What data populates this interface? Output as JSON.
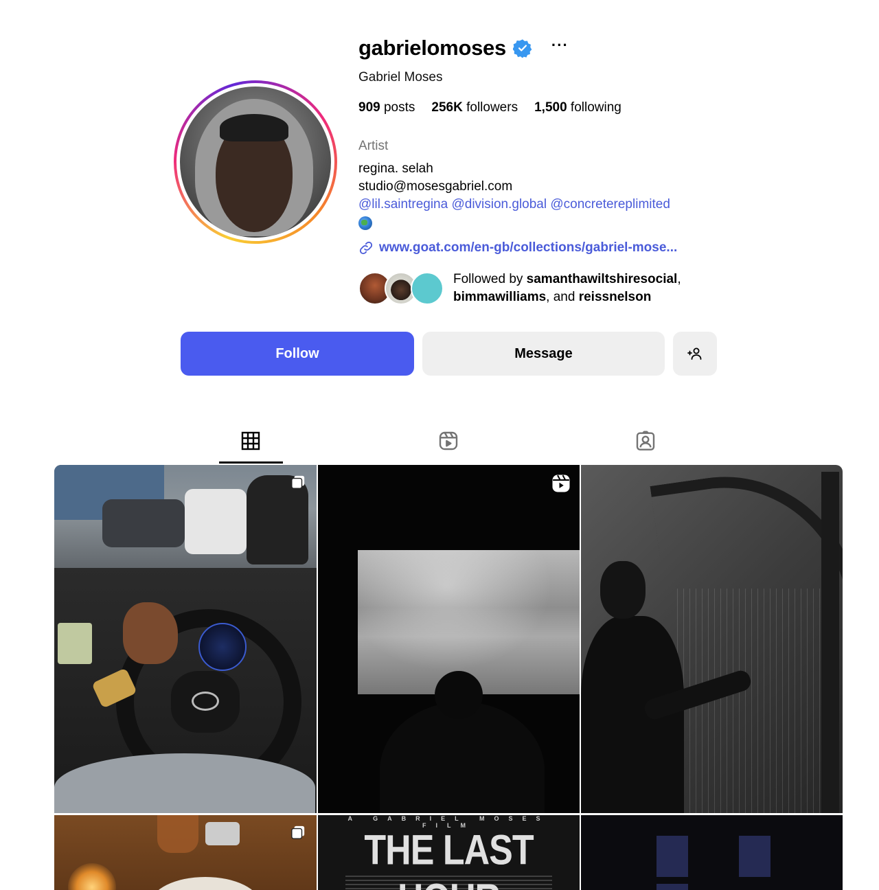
{
  "profile": {
    "username": "gabrielomoses",
    "more_label": "···",
    "full_name": "Gabriel Moses",
    "stats": {
      "posts_count": "909",
      "posts_label": "posts",
      "followers_count": "256K",
      "followers_label": "followers",
      "following_count": "1,500",
      "following_label": "following"
    },
    "category": "Artist",
    "bio_lines": [
      "regina. selah",
      "studio@mosesgabriel.com"
    ],
    "mentions": "@lil.saintregina @division.global @concretereplimited",
    "link": "www.goat.com/en-gb/collections/gabriel-mose...",
    "followed_by": {
      "prefix": "Followed by ",
      "user1": "samanthawiltshiresocial",
      "sep": ",",
      "user2": "bimmawilliams",
      "and": ", and ",
      "user3": "reissnelson"
    }
  },
  "actions": {
    "follow_label": "Follow",
    "message_label": "Message"
  },
  "tabs": [
    {
      "icon": "grid-icon",
      "active": true
    },
    {
      "icon": "reels-icon",
      "active": false
    },
    {
      "icon": "tagged-icon",
      "active": false
    }
  ],
  "posts": [
    {
      "type": "carousel",
      "subject": "car interior"
    },
    {
      "type": "reel",
      "subject": "cinema screen"
    },
    {
      "type": "image",
      "subject": "harp portrait"
    },
    {
      "type": "carousel",
      "subject": "dinner table"
    },
    {
      "type": "image",
      "subject": "film poster"
    },
    {
      "type": "image",
      "subject": "night building"
    }
  ],
  "poster": {
    "kicker": "A GABRIEL MOSES FILM",
    "title": "THE LAST HOUR"
  },
  "colors": {
    "accent": "#4a5bef",
    "link": "#4a5bd9",
    "verified": "#3897f0",
    "muted": "#737373",
    "button_secondary": "#efefef"
  }
}
